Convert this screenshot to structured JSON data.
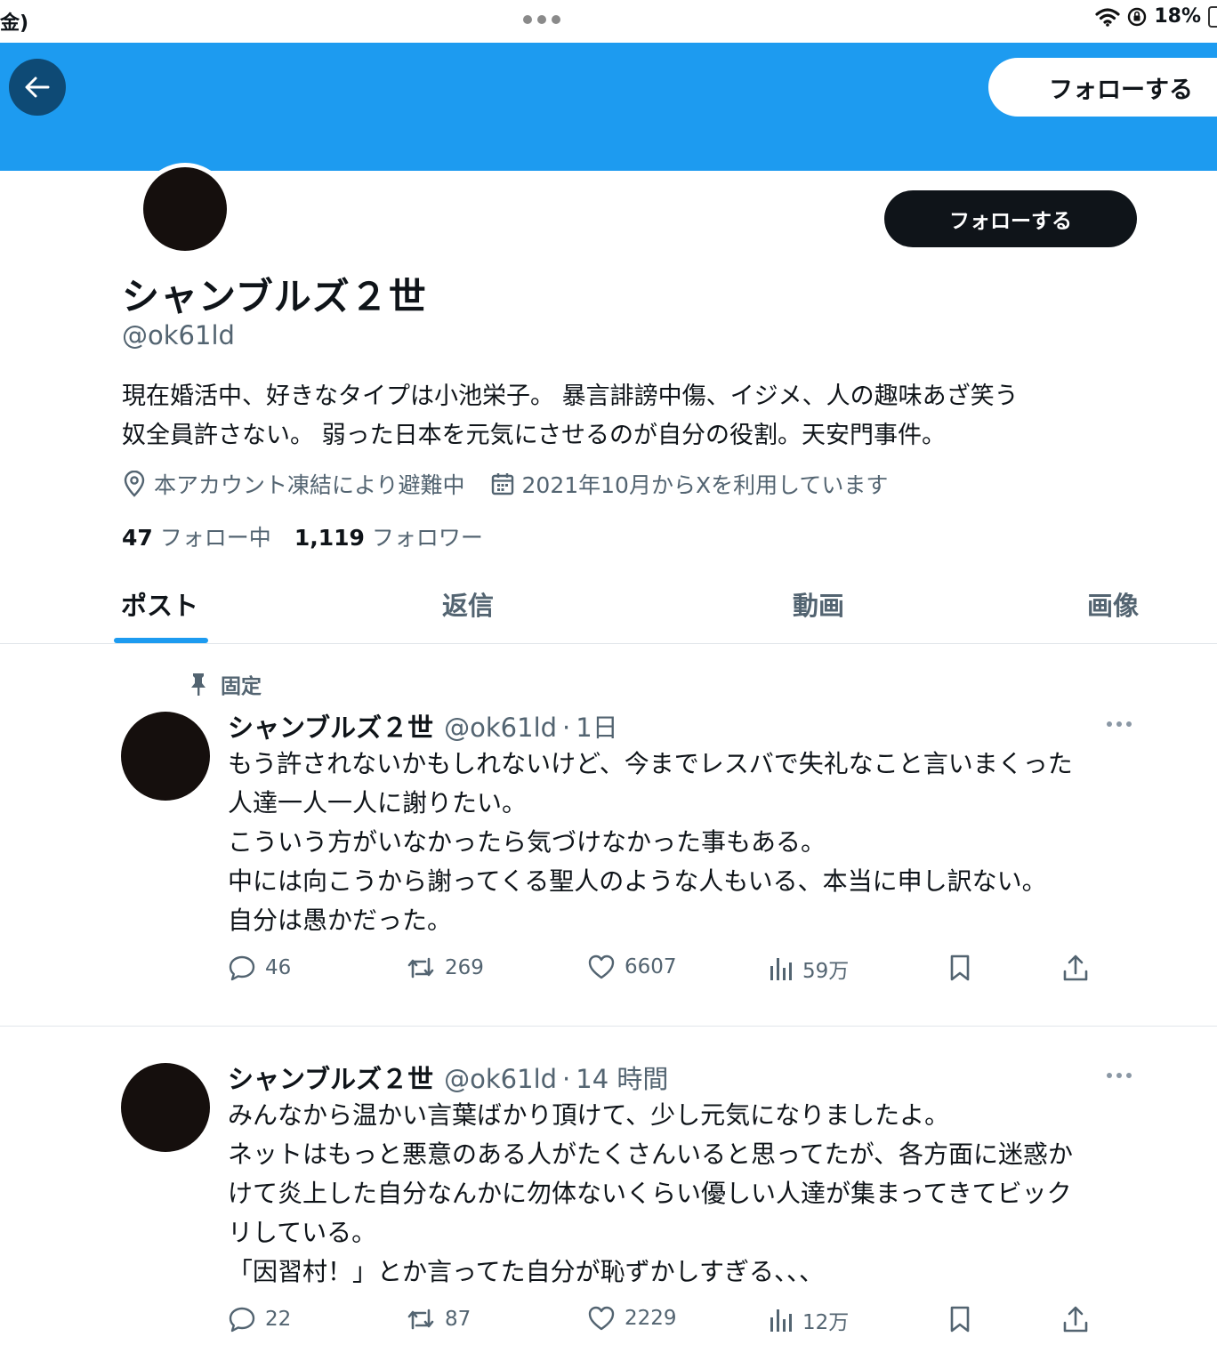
{
  "status_bar": {
    "left_text": "金)",
    "battery": "18%"
  },
  "header": {
    "follow_label": "フォローする"
  },
  "profile": {
    "follow_label": "フォローする",
    "display_name": "シャンブルズ２世",
    "handle": "@ok61ld",
    "bio_lines": [
      "現在婚活中、好きなタイプは小池栄子。 暴言誹謗中傷、イジメ、人の趣味あざ笑う",
      "奴全員許さない。 弱った日本を元気にさせるのが自分の役割。天安門事件。"
    ],
    "location": "本アカウント凍結により避難中",
    "joined": "2021年10月からXを利用しています",
    "following_count": "47",
    "following_label": "フォロー中",
    "followers_count": "1,119",
    "followers_label": "フォロワー"
  },
  "tabs": [
    {
      "label": "ポスト",
      "active": true
    },
    {
      "label": "返信",
      "active": false
    },
    {
      "label": "動画",
      "active": false
    },
    {
      "label": "画像",
      "active": false
    }
  ],
  "posts": [
    {
      "pinned_label": "固定",
      "name": "シャンブルズ２世",
      "handle": "@ok61ld",
      "time": "1日",
      "lines": [
        "もう許されないかもしれないけど、今までレスバで失礼なこと言いまくった",
        "人達一人一人に謝りたい。",
        "こういう方がいなかったら気づけなかった事もある。",
        "中には向こうから謝ってくる聖人のような人もいる、本当に申し訳ない。",
        "自分は愚かだった。"
      ],
      "replies": "46",
      "reposts": "269",
      "likes": "6607",
      "views": "59万"
    },
    {
      "name": "シャンブルズ２世",
      "handle": "@ok61ld",
      "time": "14 時間",
      "lines": [
        "みんなから温かい言葉ばかり頂けて、少し元気になりましたよ。",
        "ネットはもっと悪意のある人がたくさんいると思ってたが、各方面に迷惑か",
        "けて炎上した自分なんかに勿体ないくらい優しい人達が集まってきてビック",
        "リしている。",
        "「因習村！」とか言ってた自分が恥ずかしすぎる、、、"
      ],
      "replies": "22",
      "reposts": "87",
      "likes": "2229",
      "views": "12万"
    }
  ],
  "colors": {
    "accent": "#1d9bf0",
    "text": "#0f1419",
    "muted": "#536471",
    "back_button": "#0e4a75"
  }
}
